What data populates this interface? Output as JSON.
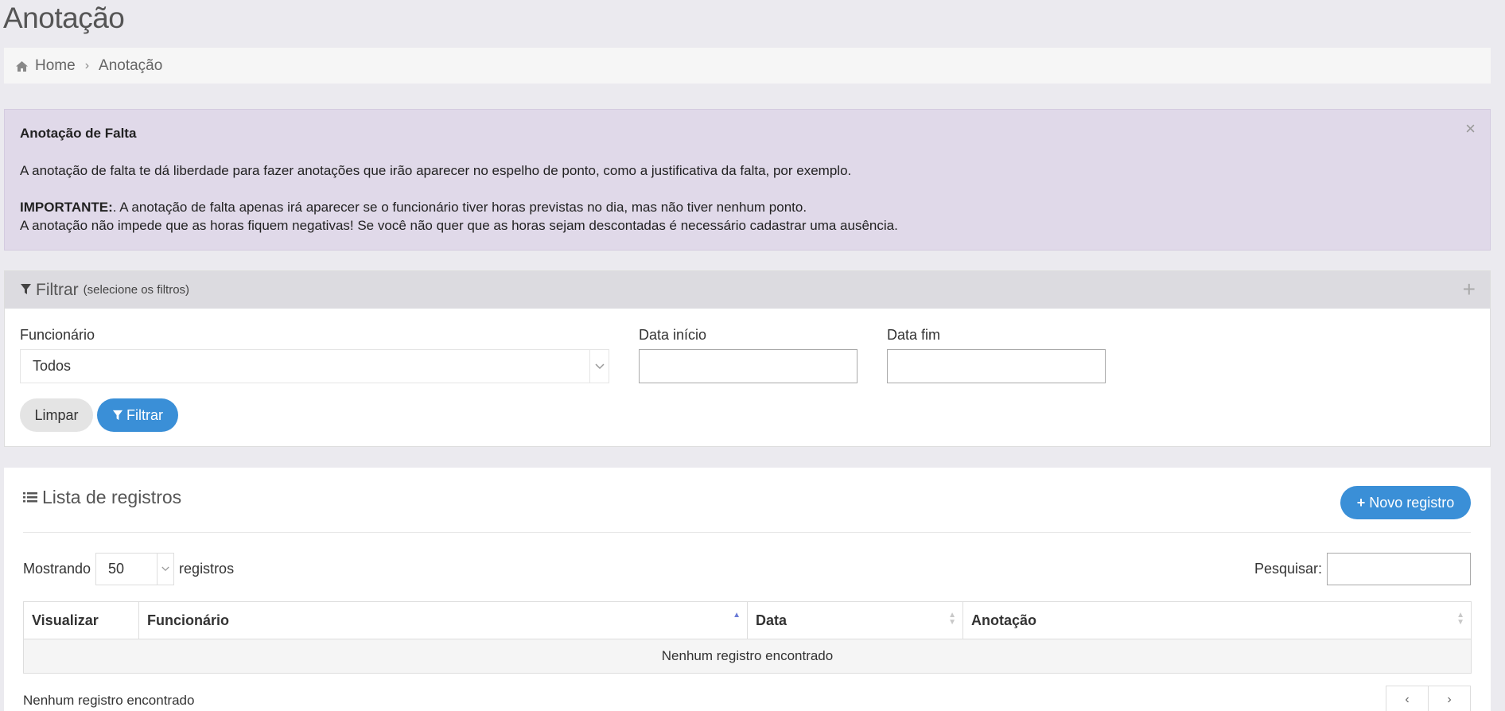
{
  "page": {
    "title": "Anotação"
  },
  "breadcrumb": {
    "home": "Home",
    "current": "Anotação"
  },
  "alert": {
    "title": "Anotação de Falta",
    "line1": "A anotação de falta te dá liberdade para fazer anotações que irão aparecer no espelho de ponto, como a justificativa da falta, por exemplo.",
    "important_label": "IMPORTANTE:",
    "line2": ". A anotação de falta apenas irá aparecer se o funcionário tiver horas previstas no dia, mas não tiver nenhum ponto.",
    "line3": "A anotação não impede que as horas fiquem negativas! Se você não quer que as horas sejam descontadas é necessário cadastrar uma ausência.",
    "close": "×"
  },
  "filter": {
    "title": "Filtrar",
    "subtitle": "(selecione os filtros)",
    "expand": "+",
    "funcionario_label": "Funcionário",
    "funcionario_value": "Todos",
    "data_inicio_label": "Data início",
    "data_inicio_value": "",
    "data_fim_label": "Data fim",
    "data_fim_value": "",
    "clear_label": "Limpar",
    "filter_label": "Filtrar"
  },
  "list": {
    "title": "Lista de registros",
    "new_label": "Novo registro",
    "showing_label": "Mostrando",
    "page_length": "50",
    "records_label": "registros",
    "search_label": "Pesquisar:",
    "search_value": "",
    "columns": [
      "Visualizar",
      "Funcionário",
      "Data",
      "Anotação"
    ],
    "empty_message": "Nenhum registro encontrado",
    "info": "Nenhum registro encontrado",
    "prev": "‹",
    "next": "›"
  },
  "colors": {
    "primary": "#3a8fd7",
    "alert_bg": "#e0d9e9",
    "page_bg": "#ebeaef"
  },
  "icons": {
    "home": "home-icon",
    "filter": "filter-icon",
    "list": "list-icon",
    "plus": "plus-icon"
  }
}
